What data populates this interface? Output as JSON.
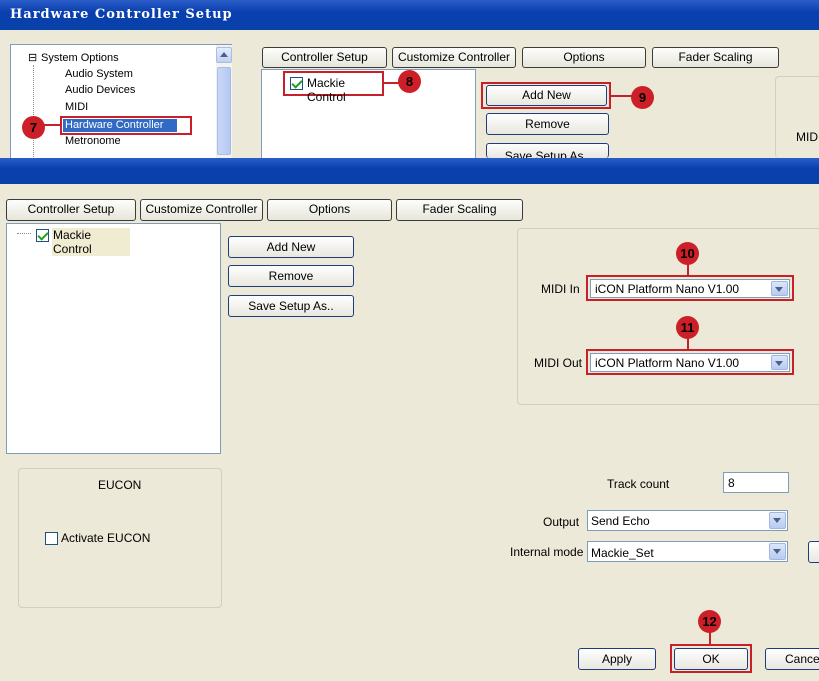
{
  "top_window": {
    "title": "Hardware Controller Setup",
    "tree": {
      "root": "System Options",
      "root_toggle": "⊟",
      "items": [
        "Audio System",
        "Audio Devices",
        "MIDI",
        "Hardware Controller",
        "Metronome"
      ],
      "selected": "Hardware Controller"
    },
    "tabs": [
      "Controller Setup",
      "Customize Controller",
      "Options",
      "Fader Scaling"
    ],
    "controller": "Mackie Control",
    "buttons": [
      "Add New",
      "Remove",
      "Save Setup As.."
    ],
    "partial_label": "MID"
  },
  "main_window": {
    "tabs": [
      "Controller Setup",
      "Customize Controller",
      "Options",
      "Fader Scaling"
    ],
    "controller": "Mackie Control",
    "buttons": {
      "add_new": "Add New",
      "remove": "Remove",
      "save_setup": "Save Setup As.."
    },
    "midi_in": {
      "label": "MIDI In",
      "value": "iCON Platform Nano V1.00"
    },
    "midi_out": {
      "label": "MIDI Out",
      "value": "iCON Platform Nano V1.00"
    },
    "eucon": {
      "title": "EUCON",
      "activate_label": "Activate EUCON",
      "checked": false
    },
    "track_count": {
      "label": "Track count",
      "value": "8"
    },
    "output": {
      "label": "Output",
      "value": "Send Echo"
    },
    "internal_mode": {
      "label": "Internal mode",
      "value": "Mackie_Set"
    },
    "footer": {
      "apply": "Apply",
      "ok": "OK",
      "cancel": "Cance"
    }
  },
  "callouts": [
    "7",
    "8",
    "9",
    "10",
    "11",
    "12"
  ],
  "colors": {
    "title_bar": "#0a3fb0",
    "highlight": "#c8202a",
    "selection": "#316ac5",
    "dialog_bg": "#ece9d8"
  }
}
